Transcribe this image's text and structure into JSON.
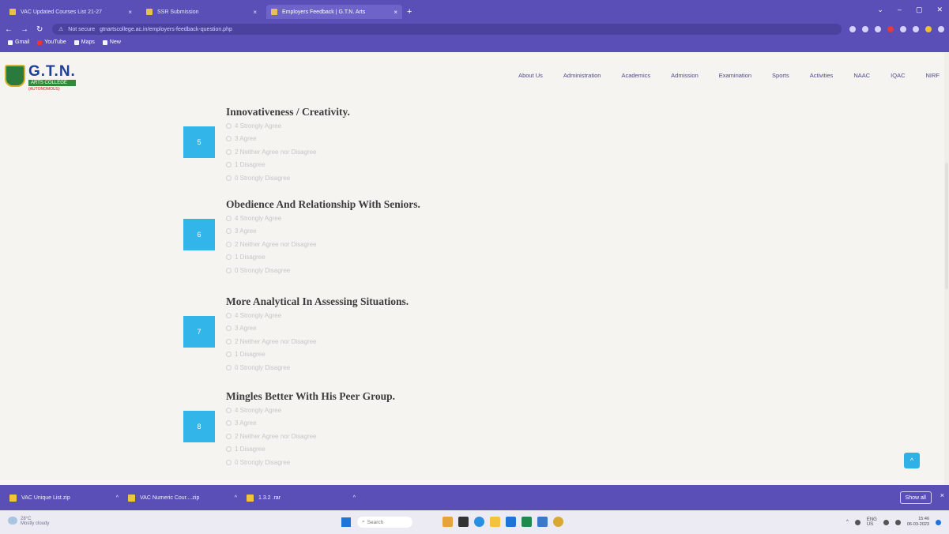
{
  "browser": {
    "tabs": [
      {
        "label": "VAC Updated Courses List 21-27",
        "active": false
      },
      {
        "label": "SSR Submission",
        "active": false
      },
      {
        "label": "Employers Feedback | G.T.N. Arts",
        "active": true
      }
    ],
    "new_tab_symbol": "+",
    "url_security": "Not secure",
    "url": "gtnartscollege.ac.in/employers-feedback-question.php",
    "bookmarks": [
      {
        "label": "Gmail",
        "icon": "gmail-icon"
      },
      {
        "label": "YouTube",
        "icon": "youtube-icon"
      },
      {
        "label": "Maps",
        "icon": "maps-icon"
      },
      {
        "label": "New",
        "icon": "globe-icon"
      }
    ]
  },
  "site": {
    "logo_name": "G.T.N.",
    "logo_sub": "ARTS COLLEGE",
    "logo_tag": "(AUTONOMOUS)",
    "nav": [
      "About Us",
      "Administration",
      "Academics",
      "Admission",
      "Examination",
      "Sports",
      "Activities",
      "NAAC",
      "IQAC",
      "NIRF"
    ]
  },
  "questions": [
    {
      "number": "5",
      "title": "Innovativeness / Creativity.",
      "options": [
        "4 Strongly Agree",
        "3 Agree",
        "2 Neither Agree nor Disagree",
        "1 Disagree",
        "0 Strongly Disagree"
      ]
    },
    {
      "number": "6",
      "title": "Obedience And Relationship With Seniors.",
      "options": [
        "4 Strongly Agree",
        "3 Agree",
        "2 Neither Agree nor Disagree",
        "1 Disagree",
        "0 Strongly Disagree"
      ]
    },
    {
      "number": "7",
      "title": "More Analytical In Assessing Situations.",
      "options": [
        "4 Strongly Agree",
        "3 Agree",
        "2 Neither Agree nor Disagree",
        "1 Disagree",
        "0 Strongly Disagree"
      ]
    },
    {
      "number": "8",
      "title": "Mingles Better With His Peer Group.",
      "options": [
        "4 Strongly Agree",
        "3 Agree",
        "2 Neither Agree nor Disagree",
        "1 Disagree",
        "0 Strongly Disagree"
      ]
    }
  ],
  "back_to_top_symbol": "^",
  "downloads": {
    "items": [
      {
        "label": "VAC Unique List.zip"
      },
      {
        "label": "VAC Numeric Cour....zip"
      },
      {
        "label": "1.3.2 .rar"
      }
    ],
    "show_all": "Show all",
    "close_symbol": "×"
  },
  "taskbar": {
    "weather_temp": "28°C",
    "weather_desc": "Mostly cloudy",
    "search_placeholder": "Search",
    "lang": "ENG",
    "lang_sub": "US",
    "time": "15:46",
    "date": "06-03-2023"
  },
  "colors": {
    "chrome": "#5a4fb7",
    "question_badge": "#32b6ea",
    "logo_blue": "#1c3f99",
    "logo_green": "#2f8b3b"
  }
}
